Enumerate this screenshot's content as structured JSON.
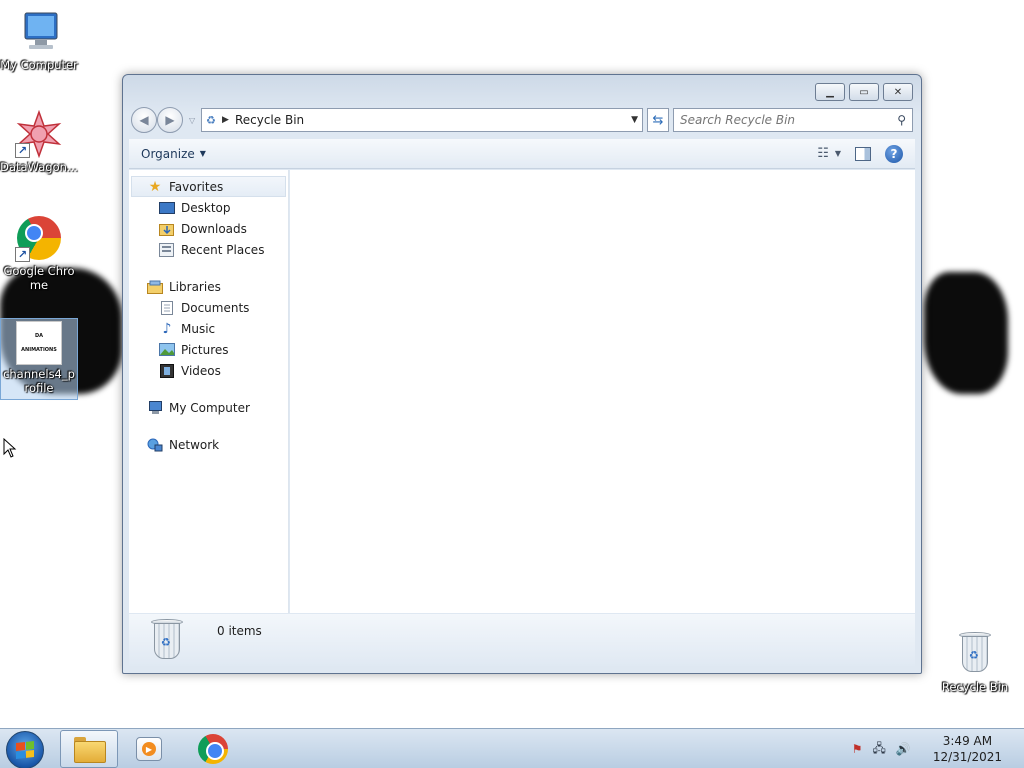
{
  "desktop": {
    "icons": [
      {
        "label": "My Computer",
        "icon": "computer-icon"
      },
      {
        "label": "DataWagon...",
        "icon": "datawagon-icon"
      },
      {
        "label": "Google Chrome",
        "icon": "chrome-icon"
      },
      {
        "label": "channels4_profile",
        "icon": "image-file-icon",
        "thumb_text": "DA ANIMATIONS"
      },
      {
        "label": "Recycle Bin",
        "icon": "recycle-bin-icon"
      }
    ]
  },
  "window": {
    "title": "Recycle Bin",
    "address": {
      "crumb": "Recycle Bin"
    },
    "search": {
      "placeholder": "Search Recycle Bin"
    },
    "toolbar": {
      "organize_label": "Organize"
    },
    "nav": {
      "favorites": {
        "label": "Favorites",
        "items": [
          "Desktop",
          "Downloads",
          "Recent Places"
        ]
      },
      "libraries": {
        "label": "Libraries",
        "items": [
          "Documents",
          "Music",
          "Pictures",
          "Videos"
        ]
      },
      "computer": {
        "label": "My Computer"
      },
      "network": {
        "label": "Network"
      }
    },
    "details": {
      "count": "0 items"
    }
  },
  "taskbar": {
    "clock": {
      "time": "3:49 AM",
      "date": "12/31/2021"
    }
  },
  "colors": {
    "accent": "#1a56a8",
    "window_frame": "#dfe8f2"
  }
}
